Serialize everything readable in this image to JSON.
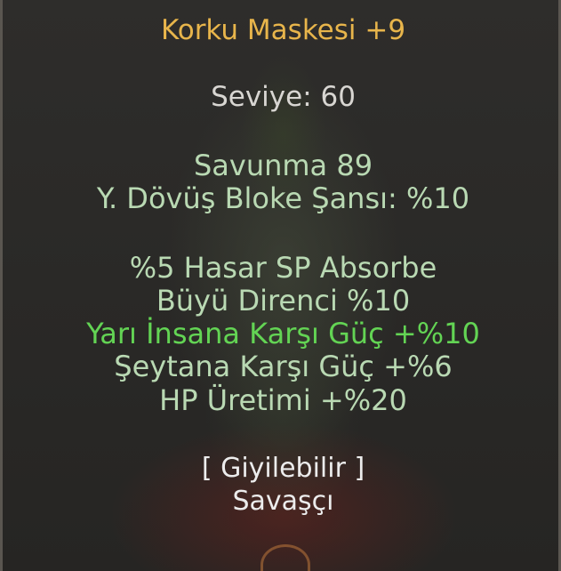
{
  "item": {
    "name": "Korku Maskesi +9",
    "level": "Seviye: 60"
  },
  "stats": [
    "Savunma 89",
    "Y. Dövüş Bloke Şansı: %10"
  ],
  "bonuses": [
    "%5 Hasar SP Absorbe",
    "Büyü Direnci %10",
    "Yarı İnsana Karşı Güç +%10",
    "Şeytana Karşı Güç +%6",
    "HP Üretimi +%20"
  ],
  "wear": {
    "status": "[ Giyilebilir ]",
    "class": "Savaşçı"
  },
  "colors": {
    "name": "#e8b54b",
    "level": "#d8d6d2",
    "stat": "#b9d9b3",
    "highlight_bonus": "#63d454",
    "wear": "#ececec"
  }
}
